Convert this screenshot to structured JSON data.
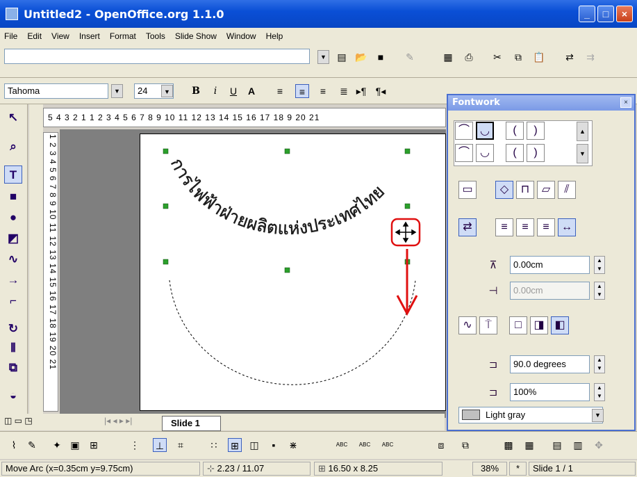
{
  "window": {
    "title": "Untitled2 - OpenOffice.org 1.1.0"
  },
  "menu": [
    "File",
    "Edit",
    "View",
    "Insert",
    "Format",
    "Tools",
    "Slide Show",
    "Window",
    "Help"
  ],
  "font": {
    "name": "Tahoma",
    "size": "24"
  },
  "ruler": {
    "horizontal": "5  4  3  2  1     1  2  3  4  5  6  7  8  9 10 11 12 13 14 15 16 17 18  9 20 21",
    "vertical": "1  2  3  4  5  6  7  8  9 10 11 12 13 14 15 16 17 18 19 20 21"
  },
  "slide": {
    "arc_text": "การไฟฟ้าฝ่ายผลิตแห่งประเทศไทย"
  },
  "tabs": {
    "slide_tab": "Slide 1"
  },
  "fontwork": {
    "title": "Fontwork",
    "distance": "0.00cm",
    "indent": "0.00cm",
    "angle": "90.0 degrees",
    "size": "100%",
    "shadow_color": "Light gray"
  },
  "status": {
    "action": "Move Arc (x=0.35cm y=9.75cm)",
    "position": "2.23 / 11.07",
    "size": "16.50 x 8.25",
    "zoom": "38%",
    "modified": "*",
    "page": "Slide 1 / 1"
  },
  "colors": {
    "annotation": "#e01010",
    "titlebar": "#0a4fd6",
    "handle": "#2ca02c"
  },
  "icons": {
    "window": "openoffice-icon",
    "move": "move-cursor-icon"
  }
}
